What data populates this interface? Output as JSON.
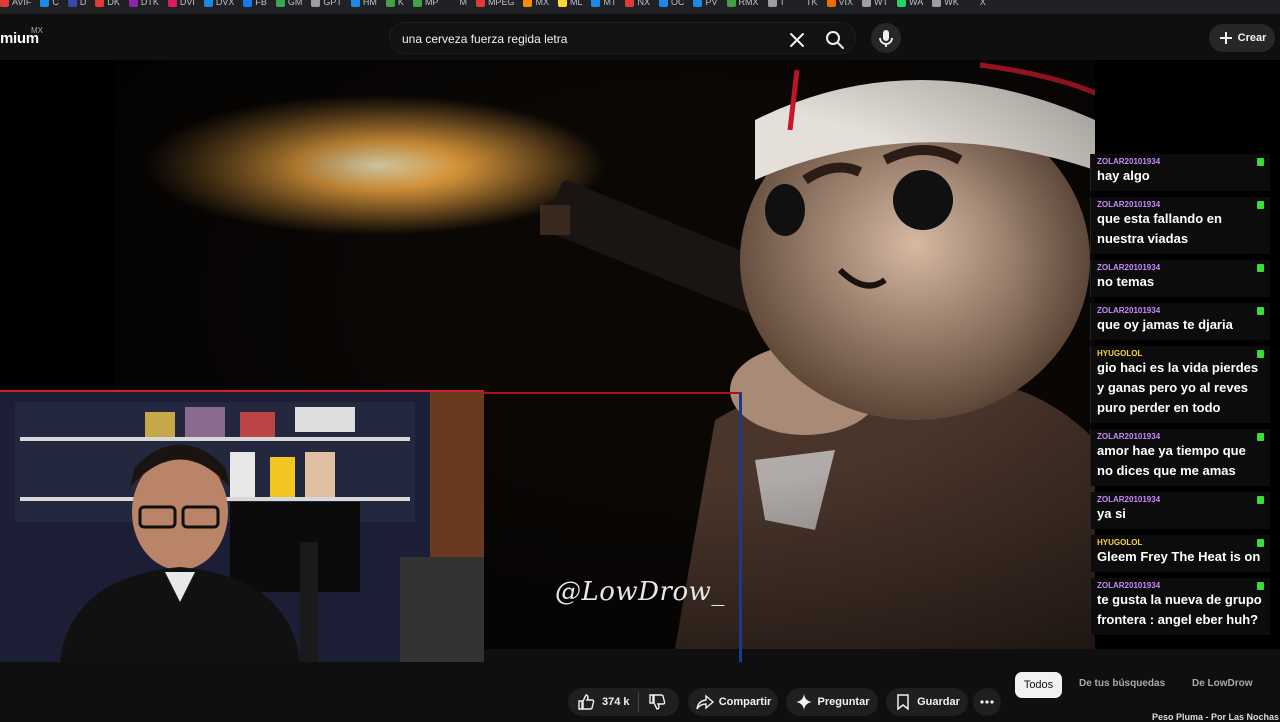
{
  "bookmarks": [
    {
      "label": "AVIF",
      "color": "#e53935"
    },
    {
      "label": "C",
      "color": "#1e88e5"
    },
    {
      "label": "D",
      "color": "#3949ab"
    },
    {
      "label": "DK",
      "color": "#e53935"
    },
    {
      "label": "DTK",
      "color": "#8e24aa"
    },
    {
      "label": "DVI",
      "color": "#d81b60"
    },
    {
      "label": "DVX",
      "color": "#1e88e5"
    },
    {
      "label": "FB",
      "color": "#1877f2"
    },
    {
      "label": "GM",
      "color": "#34a853"
    },
    {
      "label": "GPT",
      "color": "#9e9e9e"
    },
    {
      "label": "HM",
      "color": "#1e88e5"
    },
    {
      "label": "K",
      "color": "#43a047"
    },
    {
      "label": "MP",
      "color": "#43a047"
    },
    {
      "label": "M",
      "color": "#212121"
    },
    {
      "label": "MPEG",
      "color": "#e53935"
    },
    {
      "label": "MX",
      "color": "#fb8c00"
    },
    {
      "label": "ML",
      "color": "#fdd835"
    },
    {
      "label": "MT",
      "color": "#1e88e5"
    },
    {
      "label": "NX",
      "color": "#e53935"
    },
    {
      "label": "OC",
      "color": "#1e88e5"
    },
    {
      "label": "PV",
      "color": "#1e88e5"
    },
    {
      "label": "RMX",
      "color": "#43a047"
    },
    {
      "label": "T",
      "color": "#9e9e9e"
    },
    {
      "label": "TK",
      "color": "#212121"
    },
    {
      "label": "VIX",
      "color": "#ef6c00"
    },
    {
      "label": "WT",
      "color": "#9e9e9e"
    },
    {
      "label": "WA",
      "color": "#25d366"
    },
    {
      "label": "WK",
      "color": "#9e9e9e"
    },
    {
      "label": "X",
      "color": "#212121"
    }
  ],
  "masthead": {
    "logo": "mium",
    "country": "MX",
    "search_value": "una cerveza fuerza regida letra",
    "create_label": "Crear"
  },
  "video": {
    "watermark": "@LowDrow_"
  },
  "chat": [
    {
      "user": "ZOLAR20101934",
      "color": "#c58af9",
      "text": "hay algo"
    },
    {
      "user": "ZOLAR20101934",
      "color": "#c58af9",
      "text": "que esta fallando en nuestra viadas"
    },
    {
      "user": "ZOLAR20101934",
      "color": "#c58af9",
      "text": "no temas"
    },
    {
      "user": "ZOLAR20101934",
      "color": "#c58af9",
      "text": "que oy jamas te djaria"
    },
    {
      "user": "HYUGOLOL",
      "color": "#f3d34a",
      "text": "gio haci es la vida pierdes y ganas pero yo al reves puro perder en todo"
    },
    {
      "user": "ZOLAR20101934",
      "color": "#c58af9",
      "text": "amor hae ya tiempo que no dices que me amas"
    },
    {
      "user": "ZOLAR20101934",
      "color": "#c58af9",
      "text": "ya si"
    },
    {
      "user": "HYUGOLOL",
      "color": "#f3d34a",
      "text": "Gleem Frey The Heat is on"
    },
    {
      "user": "ZOLAR20101934",
      "color": "#c58af9",
      "text": "te gusta la nueva de grupo frontera : angel eber huh?"
    }
  ],
  "actions": {
    "likes": "374 k",
    "share": "Compartir",
    "ask": "Preguntar",
    "save": "Guardar"
  },
  "filters": {
    "all": "Todos",
    "searches": "De tus búsquedas",
    "channel": "De LowDrow"
  },
  "next_video_title": "Peso Pluma - Por Las Nochas"
}
